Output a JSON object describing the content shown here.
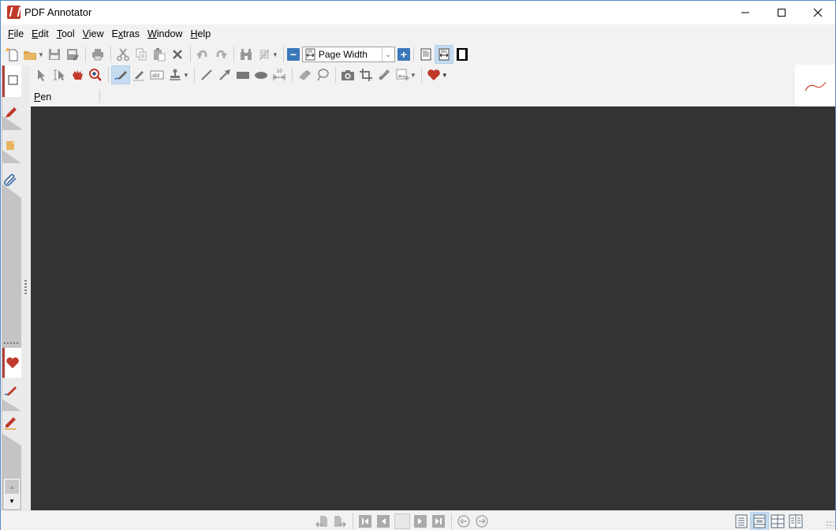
{
  "window": {
    "title": "PDF Annotator"
  },
  "menu": [
    {
      "label": "File",
      "mnemonic": "F",
      "rest": "ile"
    },
    {
      "label": "Edit",
      "mnemonic": "E",
      "rest": "dit"
    },
    {
      "label": "Tool",
      "mnemonic": "T",
      "rest": "ool"
    },
    {
      "label": "View",
      "mnemonic": "V",
      "rest": "iew"
    },
    {
      "label": "Extras",
      "mnemonic": "x",
      "pre": "E",
      "rest": "tras"
    },
    {
      "label": "Window",
      "mnemonic": "W",
      "rest": "indow"
    },
    {
      "label": "Help",
      "mnemonic": "H",
      "rest": "elp"
    }
  ],
  "toolbar": {
    "zoom_mode": "Page Width",
    "zoom_out_label": "−",
    "zoom_in_label": "+"
  },
  "tool_options": {
    "current_tool": "Pen",
    "mnemonic": "P",
    "rest": "en"
  },
  "colors": {
    "accent": "#3a78b8",
    "brand_red": "#c0392b",
    "canvas": "#333333",
    "selected": "#c5dcf0"
  },
  "statusbar": {
    "page_number": ""
  }
}
